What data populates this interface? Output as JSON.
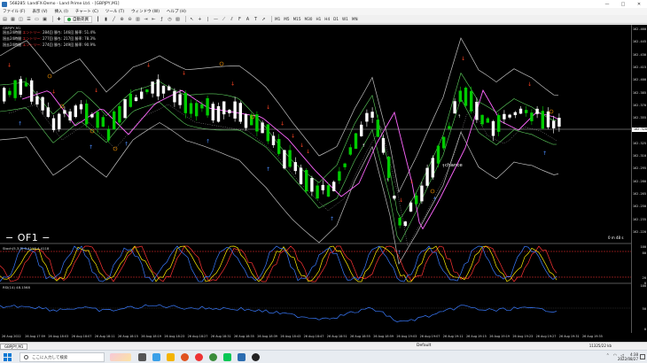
{
  "window": {
    "title": "568285: LandFX-Demo - Land Prime Ltd. - [GBPJPY,M1]",
    "controls": [
      "—",
      "□",
      "✕"
    ]
  },
  "menu": [
    "ファイル (F)",
    "表示 (V)",
    "挿入 (I)",
    "チャート (C)",
    "ツール (T)",
    "ウィンドウ (W)",
    "ヘルプ (H)"
  ],
  "toolbar": {
    "autotrade_label": "自動売買",
    "timeframes": [
      "M1",
      "M5",
      "M15",
      "M30",
      "H1",
      "H4",
      "D1",
      "W1",
      "MN"
    ]
  },
  "chart": {
    "symbol": "GBPJPY,M1",
    "stats": [
      {
        "prefix": "過去24時間",
        "entry": "エントリー:",
        "count": "284回",
        "win_label": "勝ち:",
        "win": "146回",
        "rate_label": "勝率:",
        "rate": "51.4%"
      },
      {
        "prefix": "過去24時間",
        "entry": "エントリー:",
        "count": "277回",
        "win_label": "勝ち:",
        "win": "217回",
        "rate_label": "勝率:",
        "rate": "78.3%"
      },
      {
        "prefix": "過去24時間",
        "entry": "エントリー:",
        "count": "274回",
        "win_label": "勝ち:",
        "win": "249回",
        "rate_label": "勝率:",
        "rate": "90.9%"
      }
    ],
    "price_ticks": [
      "162.460",
      "162.445",
      "162.430",
      "162.415",
      "162.400",
      "162.385",
      "162.370",
      "162.355",
      "162.340",
      "162.325",
      "162.310",
      "162.295",
      "162.280",
      "162.265",
      "162.250",
      "162.235",
      "162.220"
    ],
    "current_price": "162.320",
    "label_of1": "− OF1 −",
    "label_chance": "chance",
    "countdown": "0 m 48 s",
    "stoch_label": "Stoch(5,3,3) 0.4118 4.4118",
    "stoch_ticks": [
      "100",
      "80",
      "20",
      "0"
    ],
    "rsi_label": "RSI(14) 48.1568",
    "rsi_ticks": [
      "100",
      "50",
      "0"
    ],
    "time_ticks": [
      "26 Aug 2022",
      "26 Aug 17:59",
      "26 Aug 18:03",
      "26 Aug 18:07",
      "26 Aug 18:11",
      "26 Aug 18:15",
      "26 Aug 18:19",
      "26 Aug 18:23",
      "26 Aug 18:27",
      "26 Aug 18:31",
      "26 Aug 18:35",
      "26 Aug 18:39",
      "26 Aug 18:43",
      "26 Aug 18:47",
      "26 Aug 18:51",
      "26 Aug 18:55",
      "26 Aug 18:59",
      "26 Aug 19:03",
      "26 Aug 19:07",
      "26 Aug 19:11",
      "26 Aug 19:15",
      "26 Aug 19:19",
      "26 Aug 19:23",
      "26 Aug 19:27",
      "26 Aug 19:31",
      "26 Aug 19:35"
    ],
    "colors": {
      "up": "#00cc00",
      "down": "#ffffff",
      "band": "#c0c0c0",
      "ma": "#ff66ff",
      "green_line": "#5fd35f"
    }
  },
  "tabs": {
    "active": "GBPJPY,M1",
    "profile": "Default",
    "traffic": "11325/22 kb"
  },
  "taskbar": {
    "search_placeholder": "ここに入力して検索",
    "time": "4:38",
    "date": "2022/08/27"
  }
}
